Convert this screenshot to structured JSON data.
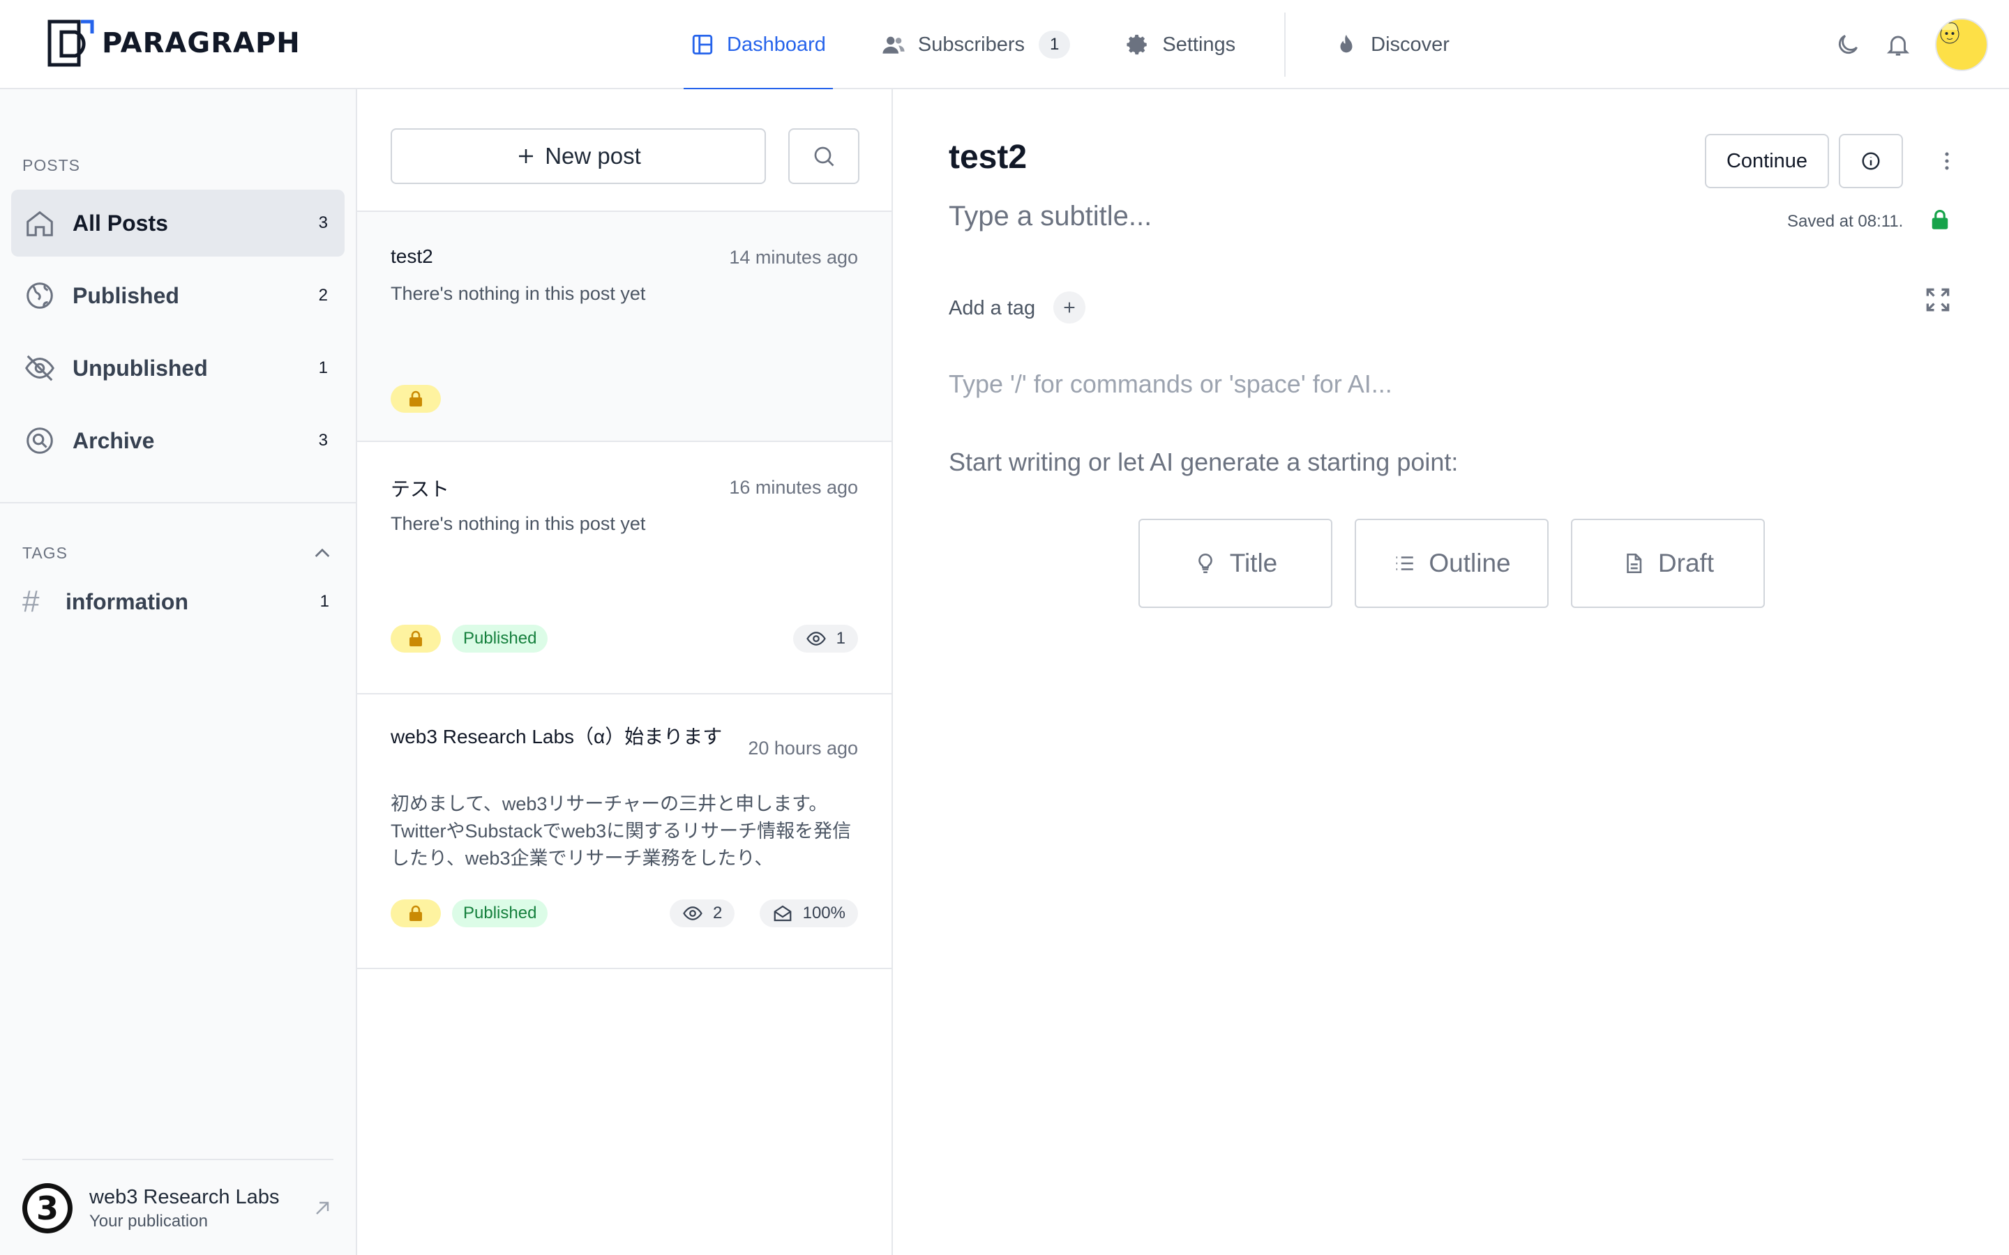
{
  "brand": {
    "name": "PARAGRAPH"
  },
  "nav": {
    "dashboard": "Dashboard",
    "subscribers": "Subscribers",
    "subscribers_count": "1",
    "settings": "Settings",
    "discover": "Discover"
  },
  "sidebar": {
    "posts_label": "POSTS",
    "items": [
      {
        "label": "All Posts",
        "count": "3",
        "icon": "home-icon"
      },
      {
        "label": "Published",
        "count": "2",
        "icon": "globe-icon"
      },
      {
        "label": "Unpublished",
        "count": "1",
        "icon": "eye-off-icon"
      },
      {
        "label": "Archive",
        "count": "3",
        "icon": "archive-icon"
      }
    ],
    "tags_label": "TAGS",
    "tags": [
      {
        "label": "information",
        "count": "1"
      }
    ],
    "publication": {
      "name": "web3 Research Labs",
      "subtitle": "Your publication",
      "avatar_text": "3"
    }
  },
  "postlist": {
    "new_post": "New post",
    "posts": [
      {
        "title": "test2",
        "time": "14 minutes ago",
        "body": "There's nothing in this post yet"
      },
      {
        "title": "テスト",
        "time": "16 minutes ago",
        "body": "There's nothing in this post yet",
        "status": "Published",
        "views": "1"
      },
      {
        "title": "web3 Research Labs（α）始まります",
        "time": "20 hours ago",
        "body": "初めまして、web3リサーチャーの三井と申します。TwitterやSubstackでweb3に関するリサーチ情報を発信したり、web3企業でリサーチ業務をしたり、",
        "status": "Published",
        "views": "2",
        "open_rate": "100%"
      }
    ]
  },
  "editor": {
    "title": "test2",
    "subtitle_placeholder": "Type a subtitle...",
    "continue": "Continue",
    "saved": "Saved at 08:11.",
    "add_tag": "Add a tag",
    "body_placeholder": "Type '/' for commands or 'space' for AI...",
    "start_hint": "Start writing or let AI generate a starting point:",
    "generate": {
      "title": "Title",
      "outline": "Outline",
      "draft": "Draft"
    }
  },
  "colors": {
    "accent": "#2563eb",
    "published_bg": "#dcfce7",
    "published_text": "#15803d",
    "lock_bg": "#fef3a0",
    "lock": "#ca8a04",
    "saved_lock": "#16a34a"
  }
}
